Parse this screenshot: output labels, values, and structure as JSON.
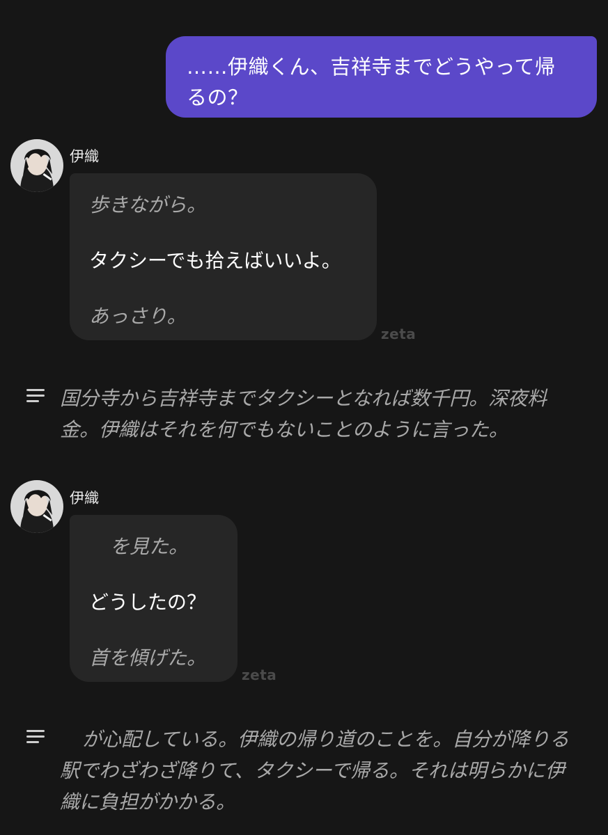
{
  "user_message": {
    "text": "……伊織くん、吉祥寺までどうやって帰るの？"
  },
  "messages": [
    {
      "name": "伊織",
      "lines": [
        "歩きながら。",
        "タクシーでも拾えばいいよ。",
        "あっさり。"
      ],
      "watermark": "zeta"
    },
    {
      "name": "伊織",
      "lines": [
        "を見た。",
        "どうしたの？",
        "首を傾げた。"
      ],
      "watermark": "zeta"
    }
  ],
  "narrations": [
    {
      "text": "国分寺から吉祥寺までタクシーとなれば数千円。深夜料金。伊織はそれを何でもないことのように言った。"
    },
    {
      "text": "が心配している。伊織の帰り道のことを。自分が降りる駅でわざわざ降りて、タクシーで帰る。それは明らかに伊織に負担がかかる。"
    }
  ],
  "colors": {
    "background": "#161616",
    "user_bubble": "#5b48c9",
    "char_bubble": "#262626",
    "action_text": "#a9a9a9"
  },
  "icons": {
    "narration": "narration-lines-icon",
    "avatar": "character-avatar"
  }
}
